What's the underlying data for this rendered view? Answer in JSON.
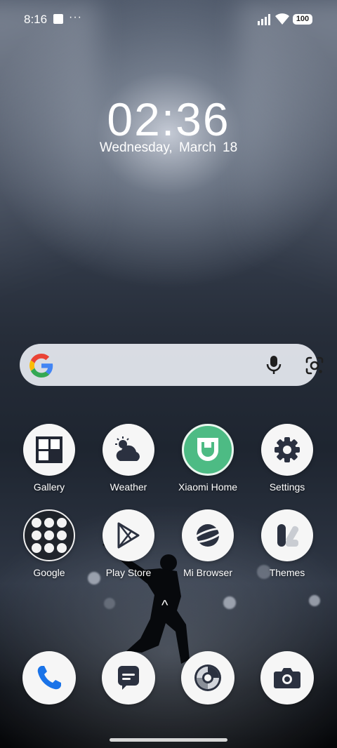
{
  "status_bar": {
    "time": "8:16",
    "more": "···",
    "battery": "100"
  },
  "clock": {
    "time": "02:36",
    "date": "Wednesday,  March  18"
  },
  "search_bar": {
    "icons": [
      "google-g-icon",
      "microphone-icon",
      "google-lens-icon"
    ]
  },
  "apps": [
    {
      "label": "Gallery",
      "icon": "gallery-icon"
    },
    {
      "label": "Weather",
      "icon": "weather-icon"
    },
    {
      "label": "Xiaomi Home",
      "icon": "xiaomi-home-icon"
    },
    {
      "label": "Settings",
      "icon": "settings-gear-icon"
    },
    {
      "label": "Google",
      "icon": "google-folder-icon"
    },
    {
      "label": "Play Store",
      "icon": "play-store-icon"
    },
    {
      "label": "Mi Browser",
      "icon": "mi-browser-icon"
    },
    {
      "label": "Themes",
      "icon": "themes-icon"
    }
  ],
  "dock": [
    {
      "icon": "phone-icon"
    },
    {
      "icon": "messages-icon"
    },
    {
      "icon": "camera-lens-app-icon"
    },
    {
      "icon": "camera-icon"
    }
  ],
  "swipe_hint": "^",
  "colors": {
    "mi_home_green": "#4dbb84",
    "phone_blue": "#1a73e8",
    "dark_icon": "#2b3140"
  }
}
